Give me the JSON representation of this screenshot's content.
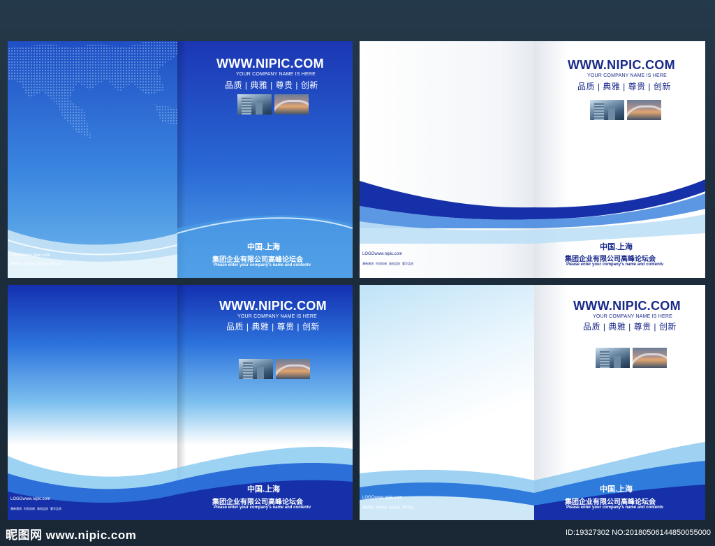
{
  "covers": {
    "site_url": "WWW.NIPIC.COM",
    "company": "YOUR COMPANY NAME IS HERE",
    "motto": "品质 | 典雅 | 尊贵 | 创新",
    "city": "中国.上海",
    "summit": "集团企业有限公司高峰论坛会",
    "enter": "Please enter your company's name and contentv",
    "logo_line": "LOGOwww.nipic.com",
    "tiny_tags": [
      "潮新潮流",
      "时尚休闲",
      "高档品质",
      "奢华品质"
    ]
  },
  "footer": {
    "watermark": "昵图网 www.nipic.com",
    "image_id": "ID:19327302 NO:20180506144850055000"
  },
  "colors": {
    "deep_blue": "#1530a8",
    "mid_blue": "#1f5fd6",
    "light_blue": "#7ec3ee",
    "navy_text": "#1a2a8a",
    "bg": "#1e2f3d"
  }
}
